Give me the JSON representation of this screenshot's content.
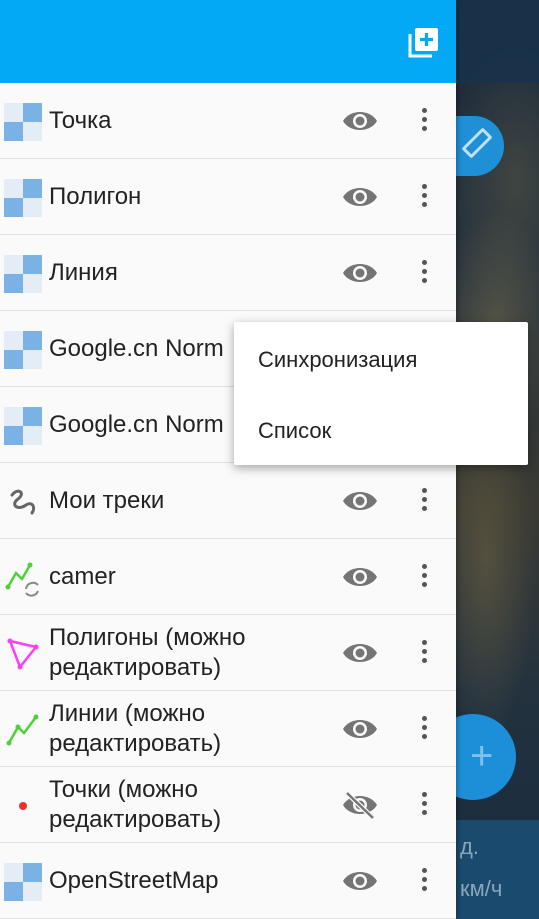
{
  "map": {
    "speed_unit_line1": "д.",
    "speed_unit_line2": "км/ч"
  },
  "header": {
    "add_layer_icon": "add-layer-icon",
    "color": "#03a9f4"
  },
  "layers": [
    {
      "label": "Точка",
      "icon": "tile-layer-icon",
      "visible": true
    },
    {
      "label": "Полигон",
      "icon": "tile-layer-icon",
      "visible": true
    },
    {
      "label": "Линия",
      "icon": "tile-layer-icon",
      "visible": true
    },
    {
      "label": "Google.cn Norm",
      "icon": "tile-layer-icon",
      "visible": true
    },
    {
      "label": "Google.cn Norm",
      "icon": "tile-layer-icon",
      "visible": true
    },
    {
      "label": "Мои треки",
      "icon": "tracks-icon",
      "visible": true
    },
    {
      "label": "camer",
      "icon": "line-sync-icon",
      "visible": true
    },
    {
      "label": "Полигоны (можно\nредактировать)",
      "icon": "polygon-icon",
      "visible": true
    },
    {
      "label": "Линии (можно\nредактировать)",
      "icon": "line-icon",
      "visible": true
    },
    {
      "label": "Точки (можно\nредактировать)",
      "icon": "point-icon",
      "visible": false
    },
    {
      "label": "OpenStreetMap",
      "icon": "tile-layer-icon",
      "visible": true
    }
  ],
  "popup_menu": {
    "items": [
      "Синхронизация",
      "Список"
    ]
  },
  "colors": {
    "accent": "#03a9f4",
    "eye": "#757575",
    "line": "#4cd137",
    "polygon": "#ff3df5",
    "point": "#f03030"
  }
}
